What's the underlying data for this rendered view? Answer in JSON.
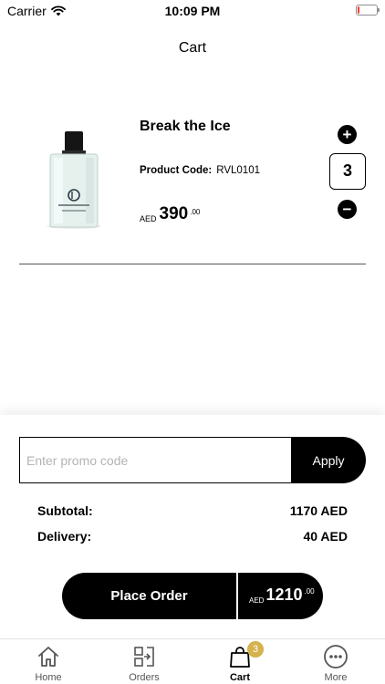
{
  "status_bar": {
    "carrier": "Carrier",
    "time": "10:09 PM",
    "battery_level_fraction": 0.1,
    "battery_color": "#ff3b30"
  },
  "header": {
    "title": "Cart"
  },
  "cart": {
    "items": [
      {
        "name": "Break the Ice",
        "code_label": "Product Code:",
        "code": "RVL0101",
        "currency": "AED",
        "price": "390",
        "price_cents": ".00",
        "quantity": "3",
        "image_icon": "perfume-bottle-icon",
        "plus_icon": "plus-icon",
        "minus_icon": "minus-icon"
      }
    ]
  },
  "promo": {
    "placeholder": "Enter promo code",
    "value": "",
    "apply_label": "Apply"
  },
  "summary": {
    "subtotal_label": "Subtotal:",
    "subtotal_value": "1170 AED",
    "delivery_label": "Delivery:",
    "delivery_value": "40 AED"
  },
  "place_order": {
    "label": "Place Order",
    "currency": "AED",
    "total": "1210",
    "total_cents": ".00"
  },
  "tab_bar": {
    "tabs": [
      {
        "label": "Home",
        "icon": "home-icon",
        "active": false
      },
      {
        "label": "Orders",
        "icon": "orders-icon",
        "active": false
      },
      {
        "label": "Cart",
        "icon": "shopping-bag-icon",
        "active": true,
        "badge": "3"
      },
      {
        "label": "More",
        "icon": "more-icon",
        "active": false
      }
    ]
  },
  "colors": {
    "accent": "#000000",
    "badge": "#d4b24c",
    "placeholder": "#b4b4b4"
  }
}
